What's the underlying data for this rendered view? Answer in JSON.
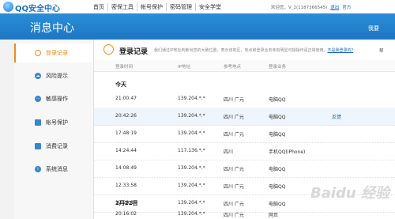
{
  "app": {
    "title": "QQ安全中心"
  },
  "topnav": [
    "首页",
    "密保工具",
    "帐号保护",
    "密码管理",
    "安全学堂"
  ],
  "account": {
    "welcome": "欢迎您，V_2(1187366545)",
    "logout": "退出",
    "official": "官方"
  },
  "header": {
    "title": "消息中心",
    "right": "我要"
  },
  "sidebar": {
    "items": [
      {
        "label": "登录记录",
        "icon": "clock-icon",
        "active": true
      },
      {
        "label": "风险提示",
        "icon": "cloud-icon",
        "active": false
      },
      {
        "label": "敏感操作",
        "icon": "dots-icon",
        "active": false
      },
      {
        "label": "帐号保护",
        "icon": "lock-icon",
        "active": false
      },
      {
        "label": "消费记录",
        "icon": "wallet-icon",
        "active": false
      },
      {
        "label": "系统消息",
        "icon": "info-icon",
        "active": false
      }
    ]
  },
  "section": {
    "title": "登录记录",
    "desc": "我们通过IP地址判断出您的大致位置，表示该地区，地点和登录业务未有明显可疑操作请正常使用。",
    "link": "不是我登录的?",
    "right": "帮"
  },
  "columns": [
    "登录时间",
    "IP地址",
    "参考地点",
    "登录业务"
  ],
  "groups": [
    {
      "date": "今天",
      "rows": [
        {
          "time": "21:00:47",
          "ip": "139.204.*.*",
          "place": "四川 广元",
          "service": "电脑QQ",
          "action": ""
        },
        {
          "time": "20:42:26",
          "ip": "139.204.*.*",
          "place": "四川 广元",
          "service": "电脑QQ",
          "action": "反馈"
        },
        {
          "time": "17:48:19",
          "ip": "139.204.*.*",
          "place": "四川 广元",
          "service": "电脑QQ",
          "action": ""
        },
        {
          "time": "14:24:44",
          "ip": "117.136.*.*",
          "place": "四川",
          "service": "手机QQ(iPhone)",
          "action": ""
        },
        {
          "time": "14:08:49",
          "ip": "139.204.*.*",
          "place": "四川 广元",
          "service": "电脑QQ",
          "action": ""
        },
        {
          "time": "12:33:58",
          "ip": "139.204.*.*",
          "place": "四川 广元",
          "service": "电脑QQ",
          "action": ""
        },
        {
          "time": "12:29:18",
          "ip": "139.204.*.*",
          "place": "四川 广元",
          "service": "电脑QQ",
          "action": ""
        }
      ]
    },
    {
      "date": "2月22日",
      "rows": [
        {
          "time": "20:16:02",
          "ip": "139.204.*.*",
          "place": "四川 广元",
          "service": "网页",
          "action": ""
        }
      ]
    }
  ],
  "watermark": "Baidu 经验"
}
